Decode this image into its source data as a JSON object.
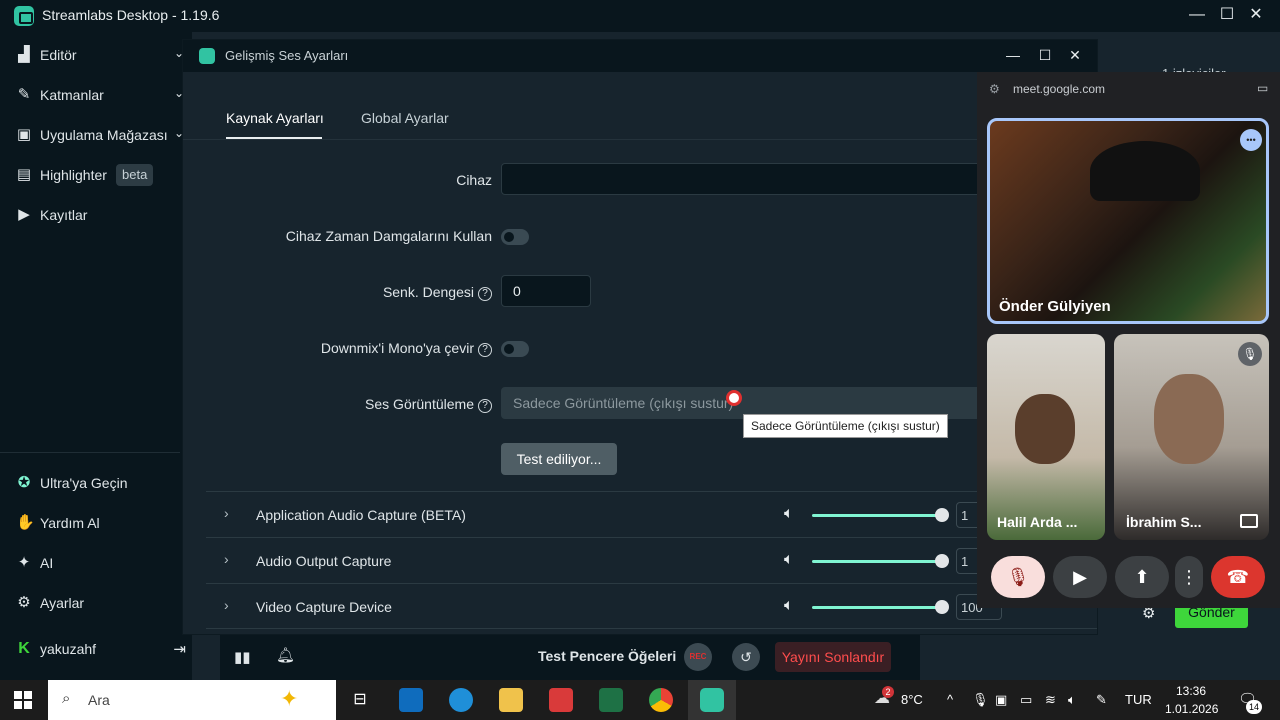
{
  "app": {
    "title": "Streamlabs Desktop - 1.19.6"
  },
  "window_controls": {
    "minimize": "—",
    "maximize": "☐",
    "close": "✕"
  },
  "sidebar": {
    "items": [
      {
        "label": "Editör",
        "icon": "editor-icon",
        "chevron": "⌄"
      },
      {
        "label": "Katmanlar",
        "icon": "layers-icon",
        "chevron": "⌄"
      },
      {
        "label": "Uygulama Mağazası",
        "icon": "store-icon",
        "chevron": "⌄"
      },
      {
        "label": "Highlighter",
        "icon": "highlighter-icon",
        "badge": "beta"
      },
      {
        "label": "Kayıtlar",
        "icon": "recordings-icon"
      }
    ],
    "bottom_items": [
      {
        "label": "Ultra'ya Geçin",
        "icon": "ultra-icon"
      },
      {
        "label": "Yardım Al",
        "icon": "help-icon"
      },
      {
        "label": "AI",
        "icon": "ai-sparkle-icon"
      },
      {
        "label": "Ayarlar",
        "icon": "gear-icon"
      }
    ],
    "user": {
      "name": "yakuzahf",
      "logout": "⇥"
    }
  },
  "dialog": {
    "title": "Gelişmiş Ses Ayarları",
    "tabs": [
      {
        "label": "Kaynak Ayarları",
        "active": true
      },
      {
        "label": "Global Ayarlar",
        "active": false
      }
    ],
    "fields": {
      "device_label": "Cihaz",
      "device_value": "",
      "timestamps_label": "Cihaz Zaman Damgalarını Kullan",
      "sync_label": "Senk. Dengesi",
      "sync_value": "0",
      "downmix_label": "Downmix'i Mono'ya çevir",
      "monitor_label": "Ses Görüntüleme",
      "monitor_placeholder": "Sadece Görüntüleme (çıkışı sustur)",
      "test_button": "Test ediliyor..."
    },
    "tooltip": "Sadece Görüntüleme (çıkışı sustur)",
    "sources": [
      {
        "name": "Application Audio Capture (BETA)",
        "volume": "1"
      },
      {
        "name": "Audio Output Capture",
        "volume": "1"
      },
      {
        "name": "Video Capture Device",
        "volume": "100"
      }
    ]
  },
  "studio": {
    "viewers": "1 izleyiciler",
    "send_button": "Gönder",
    "test_widgets": "Test Pencere Öğeleri",
    "rec": "REC",
    "end_stream": "Yayını Sonlandır"
  },
  "meet": {
    "url": "meet.google.com",
    "participants": [
      "Önder Gülyiyen",
      "Halil Arda ...",
      "İbrahim S..."
    ],
    "more": "•••"
  },
  "taskbar": {
    "search_placeholder": "Ara",
    "notification_count": "2",
    "temperature": "8°C",
    "language": "TUR",
    "time": "13:36",
    "date": "1.01.2026",
    "notifications": "14"
  },
  "colors": {
    "accent": "#80f5d2",
    "streamlabs_green": "#31c3a2",
    "end_red": "#e03030",
    "send_green": "#3ed63b"
  }
}
